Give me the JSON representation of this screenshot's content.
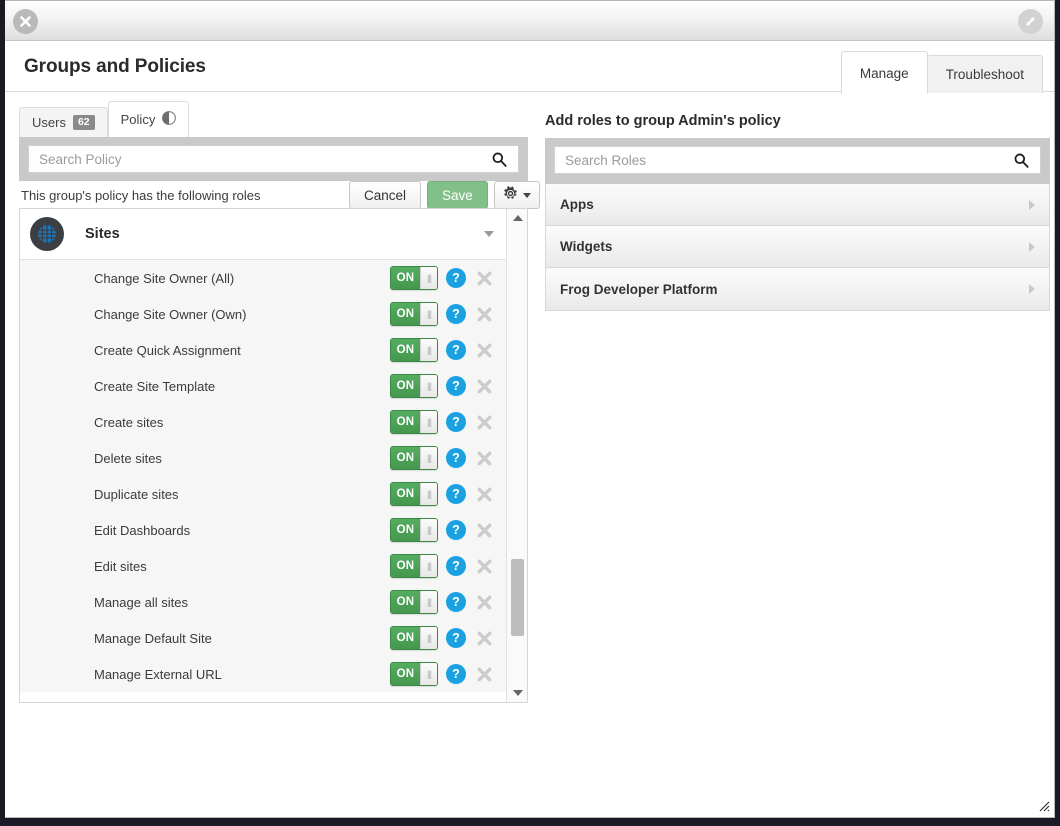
{
  "window": {
    "close_icon": "close-icon",
    "resize_icon": "maximize-icon",
    "grip_icon": "resize-grip-icon"
  },
  "header": {
    "title": "Groups and Policies"
  },
  "top_tabs": [
    {
      "label": "Manage",
      "active": true
    },
    {
      "label": "Troubleshoot",
      "active": false
    }
  ],
  "sub_tabs": [
    {
      "label": "Users",
      "badge": "62",
      "active": false
    },
    {
      "label": "Policy",
      "badge": "",
      "active": true
    }
  ],
  "toolbar": {
    "cancel_label": "Cancel",
    "save_label": "Save",
    "gear_icon": "gear-icon",
    "caret_icon": "chevron-down-icon"
  },
  "left": {
    "search": {
      "placeholder": "Search Policy",
      "value": "",
      "icon": "search-icon"
    },
    "note": "This group's policy has the following roles",
    "group": {
      "title": "Sites",
      "icon": "globe-icon",
      "chevron": "chevron-down-icon"
    },
    "toggle_on_label": "ON",
    "help_label": "?",
    "rows": [
      {
        "label": "Change Site Owner (All)",
        "state": "ON"
      },
      {
        "label": "Change Site Owner (Own)",
        "state": "ON"
      },
      {
        "label": "Create Quick Assignment",
        "state": "ON"
      },
      {
        "label": "Create Site Template",
        "state": "ON"
      },
      {
        "label": "Create sites",
        "state": "ON"
      },
      {
        "label": "Delete sites",
        "state": "ON"
      },
      {
        "label": "Duplicate sites",
        "state": "ON"
      },
      {
        "label": "Edit Dashboards",
        "state": "ON"
      },
      {
        "label": "Edit sites",
        "state": "ON"
      },
      {
        "label": "Manage all sites",
        "state": "ON"
      },
      {
        "label": "Manage Default Site",
        "state": "ON"
      },
      {
        "label": "Manage External URL",
        "state": "ON"
      }
    ],
    "scrollbar": {
      "up_icon": "scroll-up-icon",
      "down_icon": "scroll-down-icon"
    }
  },
  "right": {
    "title": "Add roles to group Admin's policy",
    "search": {
      "placeholder": "Search Roles",
      "value": "",
      "icon": "search-icon"
    },
    "roles": [
      {
        "label": "Apps"
      },
      {
        "label": "Widgets"
      },
      {
        "label": "Frog Developer Platform"
      }
    ]
  },
  "colors": {
    "toggle_on": "#4aa055",
    "help_blue": "#1ba1e2",
    "save_green": "#82c08a",
    "strip_gray": "#c9c9c9",
    "icon_dark": "#3b3f44",
    "globe_blue": "#1f74b5"
  }
}
